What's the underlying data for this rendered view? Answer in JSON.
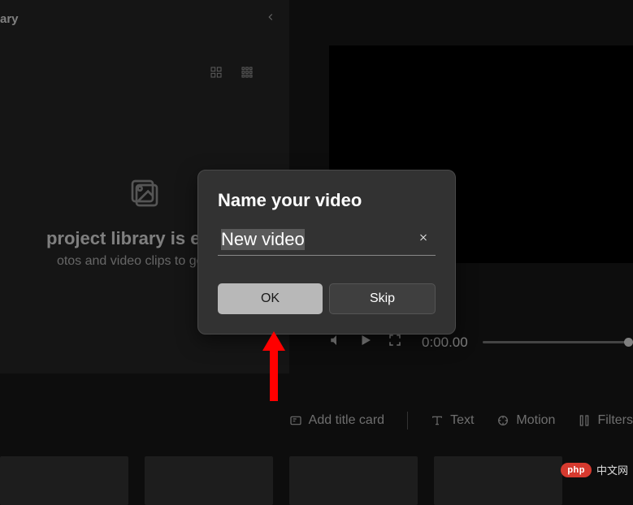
{
  "left": {
    "header_fragment": "ary",
    "empty_title": "project library is empty",
    "empty_sub": "otos and video clips to get star"
  },
  "player": {
    "timecode": "0:00.00"
  },
  "toolbar": {
    "add_title_card": "Add title card",
    "text": "Text",
    "motion": "Motion",
    "filters": "Filters"
  },
  "dialog": {
    "title": "Name your video",
    "input_value": "New video",
    "ok": "OK",
    "skip": "Skip"
  },
  "watermark": {
    "badge": "php",
    "text": "中文网"
  }
}
